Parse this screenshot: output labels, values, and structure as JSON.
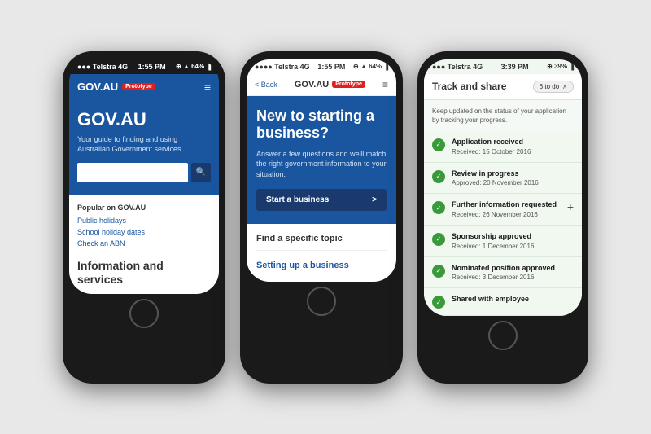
{
  "background": "#e8e8e8",
  "phone1": {
    "statusBar": {
      "left": "●●● Telstra  4G",
      "center": "1:55 PM",
      "right": "⊕ ▲ 64% ▐"
    },
    "nav": {
      "logo": "GOV.AU",
      "badge": "Prototype",
      "menu": "≡"
    },
    "hero": {
      "title": "GOV.AU",
      "subtitle": "Your guide to finding and using Australian Government services.",
      "searchPlaceholder": ""
    },
    "popular": {
      "title": "Popular on GOV.AU",
      "links": [
        "Public holidays",
        "School holiday dates",
        "Check an ABN"
      ]
    },
    "info": {
      "title": "Information and services"
    },
    "searchIcon": "🔍"
  },
  "phone2": {
    "statusBar": {
      "left": "●●●● Telstra  4G",
      "center": "1:55 PM",
      "right": "⊕ ▲ 64% ▐"
    },
    "nav": {
      "back": "< Back",
      "logo": "GOV.AU",
      "badge": "Prototype",
      "menu": "≡"
    },
    "hero": {
      "title": "New to starting a business?",
      "subtitle": "Answer a few questions and we'll match the right government information to your situation.",
      "cta": "Start a business",
      "ctaArrow": ">"
    },
    "body": {
      "findLabel": "Find a specific topic",
      "topicLink": "Setting up a business"
    }
  },
  "phone3": {
    "statusBar": {
      "left": "●●● Telstra  4G",
      "center": "3:39 PM",
      "right": "⊕ 39% ▐"
    },
    "header": {
      "title": "Track and share",
      "badge": "6 to do",
      "chevron": "∧"
    },
    "description": "Keep updated on the status of your application by tracking your progress.",
    "items": [
      {
        "title": "Application received",
        "date": "Received: 15 October 2016",
        "hasPlus": false
      },
      {
        "title": "Review in progress",
        "date": "Approved: 20 November 2016",
        "hasPlus": false
      },
      {
        "title": "Further information requested",
        "date": "Received: 26 November 2016",
        "hasPlus": true
      },
      {
        "title": "Sponsorship approved",
        "date": "Received: 1 December 2016",
        "hasPlus": false
      },
      {
        "title": "Nominated position approved",
        "date": "Received: 3 December 2016",
        "hasPlus": false
      },
      {
        "title": "Shared with employee",
        "date": "",
        "hasPlus": false
      }
    ]
  }
}
